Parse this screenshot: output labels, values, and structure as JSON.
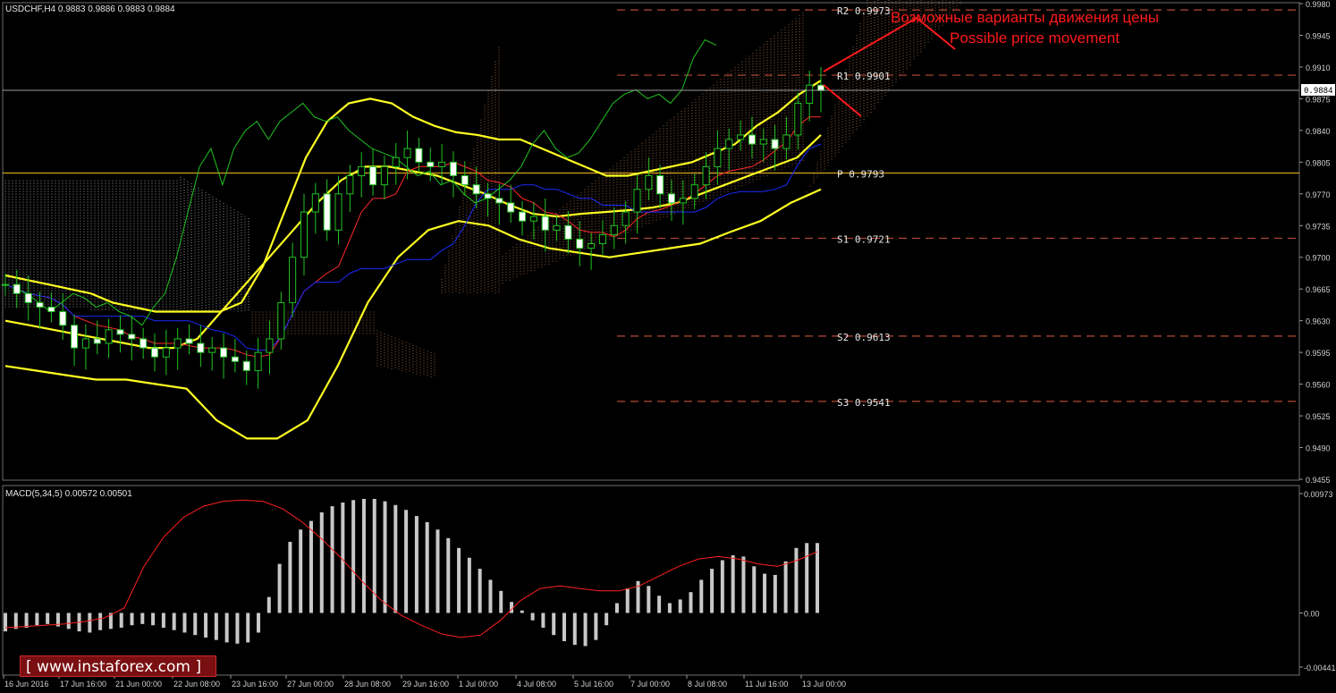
{
  "header": {
    "symbol_info": "USDCHF,H4  0.9883 0.9886 0.9883 0.9884",
    "macd_info": "MACD(5,34,5) 0.00572 0.00501"
  },
  "annotations": {
    "title_ru": "Возможные варианты движения цены",
    "title_en": "Possible price movement"
  },
  "current_price_label": "0.9884",
  "watermark": "[ www.instaforex.com ]",
  "colors": {
    "background": "#000000",
    "grid": "#6e6e6e",
    "bollinger": "#ffff22",
    "tenkan": "#ff2a2a",
    "kijun": "#1a2bff",
    "chikou": "#22c222",
    "pivot_line": "#d6a21e",
    "sr_dashes": "#b34a34",
    "annotation": "#ff1a1a",
    "macd_hist": "#c8c8c8",
    "macd_signal": "#ff2020"
  },
  "chart_data": [
    {
      "type": "candlestick",
      "symbol": "USDCHF",
      "timeframe": "H4",
      "y_ticks": [
        "0.9980",
        "0.9945",
        "0.9910",
        "0.9875",
        "0.9840",
        "0.9805",
        "0.9770",
        "0.9735",
        "0.9700",
        "0.9665",
        "0.9630",
        "0.9595",
        "0.9560",
        "0.9525",
        "0.9490",
        "0.9455"
      ],
      "ylim": [
        0.9455,
        0.998
      ],
      "x_ticks": [
        "16 Jun 2016",
        "17 Jun 16:00",
        "21 Jun 00:00",
        "22 Jun 08:00",
        "23 Jun 16:00",
        "27 Jun 00:00",
        "28 Jun 08:00",
        "29 Jun 16:00",
        "1 Jul 00:00",
        "4 Jul 08:00",
        "5 Jul 16:00",
        "7 Jul 00:00",
        "8 Jul 08:00",
        "11 Jul 16:00",
        "13 Jul 00:00"
      ],
      "levels": [
        {
          "label": "R2",
          "text": "0.9973",
          "value": 0.9973
        },
        {
          "label": "R1",
          "text": "0.9901",
          "value": 0.9901
        },
        {
          "label": "P",
          "text": "0.9793",
          "value": 0.9793
        },
        {
          "label": "S1",
          "text": "0.9721",
          "value": 0.9721
        },
        {
          "label": "S2",
          "text": "0.9613",
          "value": 0.9613
        },
        {
          "label": "S3",
          "text": "0.9541",
          "value": 0.9541
        }
      ],
      "closes": [
        0.967,
        0.966,
        0.965,
        0.9645,
        0.964,
        0.9625,
        0.96,
        0.961,
        0.9605,
        0.962,
        0.9615,
        0.961,
        0.96,
        0.959,
        0.96,
        0.961,
        0.9605,
        0.9595,
        0.96,
        0.959,
        0.9585,
        0.9575,
        0.9595,
        0.961,
        0.965,
        0.97,
        0.975,
        0.977,
        0.973,
        0.977,
        0.979,
        0.98,
        0.978,
        0.98,
        0.981,
        0.982,
        0.9805,
        0.98,
        0.9805,
        0.979,
        0.978,
        0.977,
        0.9765,
        0.976,
        0.975,
        0.974,
        0.9745,
        0.973,
        0.9735,
        0.972,
        0.971,
        0.9715,
        0.9725,
        0.9735,
        0.975,
        0.9775,
        0.979,
        0.977,
        0.976,
        0.9765,
        0.978,
        0.98,
        0.982,
        0.983,
        0.9835,
        0.9825,
        0.983,
        0.982,
        0.9835,
        0.987,
        0.989,
        0.9884
      ],
      "bollinger": {
        "upper": [
          0.968,
          0.9675,
          0.967,
          0.9665,
          0.966,
          0.965,
          0.9645,
          0.964,
          0.964,
          0.964,
          0.964,
          0.965,
          0.969,
          0.975,
          0.981,
          0.985,
          0.987,
          0.9875,
          0.987,
          0.9855,
          0.9845,
          0.9838,
          0.9835,
          0.983,
          0.983,
          0.982,
          0.981,
          0.98,
          0.979,
          0.979,
          0.9795,
          0.98,
          0.9805,
          0.9815,
          0.9825,
          0.9845,
          0.986,
          0.988,
          0.9895
        ],
        "middle": [
          0.963,
          0.9625,
          0.962,
          0.9615,
          0.961,
          0.9605,
          0.96,
          0.96,
          0.961,
          0.964,
          0.967,
          0.97,
          0.973,
          0.976,
          0.9785,
          0.98,
          0.98,
          0.9795,
          0.979,
          0.978,
          0.977,
          0.9758,
          0.9748,
          0.9745,
          0.9748,
          0.975,
          0.9752,
          0.9755,
          0.976,
          0.977,
          0.978,
          0.979,
          0.98,
          0.981,
          0.9835
        ],
        "lower": [
          0.958,
          0.9575,
          0.957,
          0.9565,
          0.9565,
          0.956,
          0.9555,
          0.952,
          0.95,
          0.95,
          0.952,
          0.958,
          0.965,
          0.97,
          0.973,
          0.974,
          0.9735,
          0.972,
          0.971,
          0.9705,
          0.97,
          0.9705,
          0.971,
          0.9715,
          0.9728,
          0.974,
          0.976,
          0.9775
        ]
      }
    },
    {
      "type": "bar",
      "name": "MACD(5,34,5)",
      "y_ticks": [
        "0.00973",
        "0.00",
        "-0.00441"
      ],
      "ylim": [
        -0.00441,
        0.00973
      ],
      "values": [
        -0.0015,
        -0.0013,
        -0.0012,
        -0.001,
        -0.0009,
        -0.0011,
        -0.0013,
        -0.0015,
        -0.0016,
        -0.0014,
        -0.0013,
        -0.0012,
        -0.001,
        -0.0009,
        -0.001,
        -0.0012,
        -0.0014,
        -0.0016,
        -0.0018,
        -0.002,
        -0.0022,
        -0.0024,
        -0.0025,
        -0.0024,
        -0.0016,
        0.0013,
        0.004,
        0.0058,
        0.0068,
        0.0075,
        0.0082,
        0.0087,
        0.009,
        0.0092,
        0.0093,
        0.0093,
        0.0091,
        0.0088,
        0.0084,
        0.0079,
        0.0074,
        0.0068,
        0.0061,
        0.0053,
        0.0045,
        0.0036,
        0.0027,
        0.0018,
        0.0009,
        0.0002,
        -0.0006,
        -0.0012,
        -0.0018,
        -0.0023,
        -0.0026,
        -0.0027,
        -0.0022,
        -0.001,
        0.0008,
        0.002,
        0.0026,
        0.0022,
        0.0014,
        0.0008,
        0.0011,
        0.0017,
        0.0027,
        0.0036,
        0.0043,
        0.0047,
        0.0046,
        0.0038,
        0.0032,
        0.0031,
        0.0042,
        0.0053,
        0.0057,
        0.0057
      ],
      "signal": [
        -0.0012,
        -0.0011,
        -0.001,
        -0.0009,
        -0.0007,
        -0.0004,
        0.0004,
        0.0038,
        0.0062,
        0.0078,
        0.0087,
        0.0091,
        0.0092,
        0.0091,
        0.0085,
        0.0074,
        0.006,
        0.0044,
        0.0026,
        0.001,
        -0.0002,
        -0.001,
        -0.0017,
        -0.002,
        -0.0018,
        -0.0006,
        0.001,
        0.002,
        0.0022,
        0.002,
        0.0018,
        0.0018,
        0.0022,
        0.003,
        0.0038,
        0.0044,
        0.0046,
        0.0044,
        0.004,
        0.0038,
        0.0043,
        0.005
      ]
    }
  ]
}
